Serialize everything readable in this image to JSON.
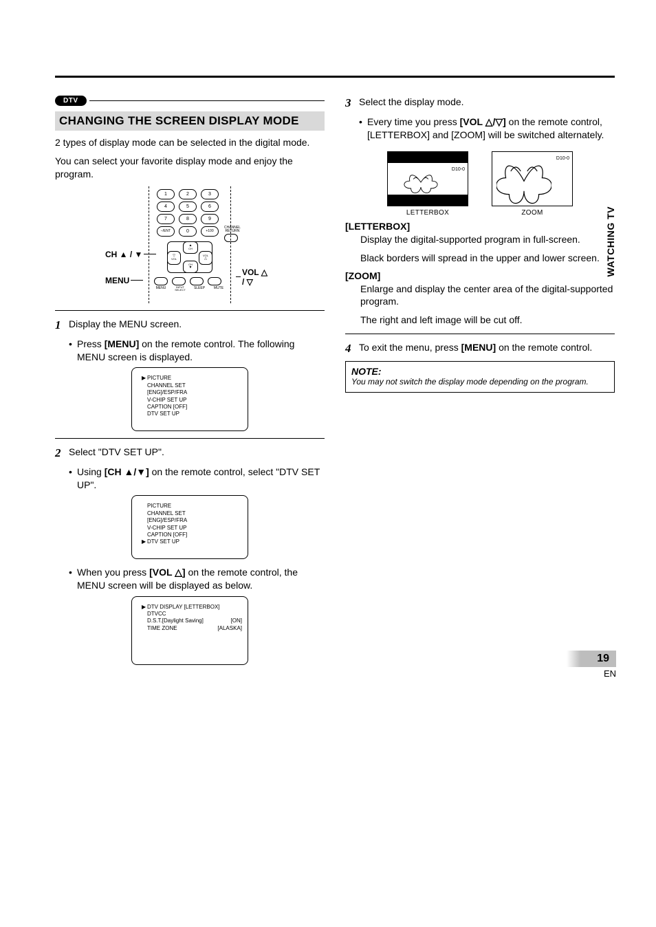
{
  "badge": {
    "dtv": "DTV"
  },
  "heading": "CHANGING THE SCREEN DISPLAY MODE",
  "intro1": "2 types of display mode can be selected in the digital mode.",
  "intro2": "You can select your favorite display mode and enjoy the program.",
  "remote_labels": {
    "ch": "CH ▲ / ▼",
    "menu": "MENU",
    "vol": "VOL △ / ▽",
    "numpad": [
      "1",
      "2",
      "3",
      "4",
      "5",
      "6",
      "7",
      "8",
      "9",
      "–/ENT",
      "0",
      "+100"
    ],
    "chret": "CHANNEL RETURN",
    "dpad_up": "CH ▲",
    "dpad_down": "CH ▼",
    "dpad_left": "▽VOL",
    "dpad_right": "VOL△",
    "bottom": [
      "MENU",
      "INPUT SELECT",
      "SLEEP",
      "MUTE"
    ]
  },
  "step1": {
    "text": "Display the MENU screen.",
    "bullet_pre": "Press ",
    "bullet_bold": "[MENU]",
    "bullet_post": " on the remote control. The following MENU screen is displayed."
  },
  "menu1": {
    "lines": [
      "PICTURE",
      "CHANNEL SET",
      "[ENG]/ESP/FRA",
      "V-CHIP SET UP",
      "CAPTION [OFF]",
      "DTV SET UP"
    ],
    "selected_index": 0
  },
  "step2": {
    "text": "Select \"DTV SET UP\".",
    "bullet1_pre": "Using ",
    "bullet1_bold": "[CH ▲/▼]",
    "bullet1_post": " on the remote control, select \"DTV SET UP\".",
    "bullet2_pre": "When you press ",
    "bullet2_bold": "[VOL △]",
    "bullet2_post": " on the remote control, the MENU screen will be displayed as below."
  },
  "menu2": {
    "lines": [
      "PICTURE",
      "CHANNEL SET",
      "[ENG]/ESP/FRA",
      "V-CHIP SET UP",
      "CAPTION [OFF]",
      "DTV SET UP"
    ],
    "selected_index": 5
  },
  "menu3": {
    "rows": [
      {
        "l": "DTV DISPLAY [LETTERBOX]",
        "r": ""
      },
      {
        "l": "DTVCC",
        "r": ""
      },
      {
        "l": "D.S.T.[Daylight Saving]",
        "r": "[ON]"
      },
      {
        "l": "TIME ZONE",
        "r": "[ALASKA]"
      }
    ],
    "selected_index": 0
  },
  "step3": {
    "text": "Select the display mode.",
    "bullet_pre": "Every time you press ",
    "bullet_bold": "[VOL △/▽]",
    "bullet_post": " on the remote control, [LETTERBOX] and [ZOOM] will be switched alternately."
  },
  "previews": {
    "ch_label": "D10-0",
    "letterbox": "LETTERBOX",
    "zoom": "ZOOM"
  },
  "modes": {
    "letterbox_title": "[LETTERBOX]",
    "letterbox_p1": "Display the digital-supported program in full-screen.",
    "letterbox_p2": "Black borders will spread in the upper and lower screen.",
    "zoom_title": "[ZOOM]",
    "zoom_p1": "Enlarge and display the center area of the digital-supported program.",
    "zoom_p2": "The right and left image will be cut off."
  },
  "step4": {
    "pre": "To exit the menu, press ",
    "bold": "[MENU]",
    "post": " on the remote control."
  },
  "note": {
    "title": "NOTE:",
    "body": "You may not switch the display mode depending on the program."
  },
  "side_tab": "WATCHING TV",
  "footer": {
    "page": "19",
    "lang": "EN"
  }
}
